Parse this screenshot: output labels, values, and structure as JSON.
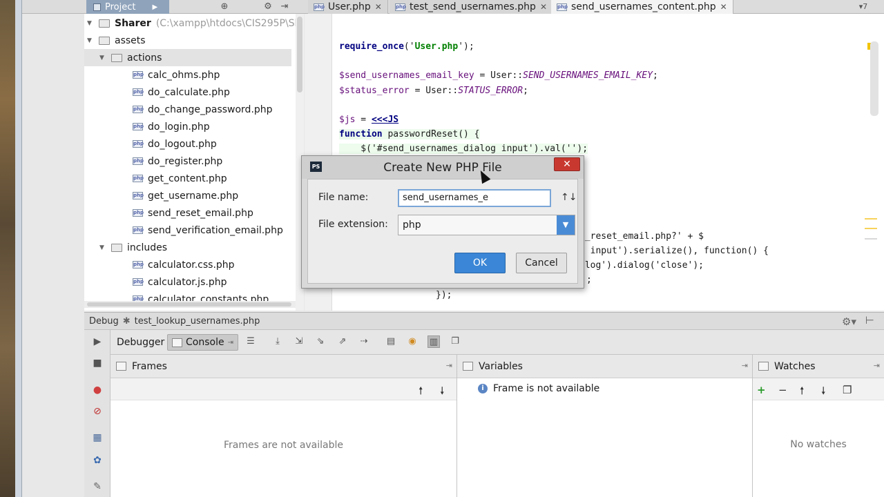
{
  "topbar": {
    "project_tab": "Project",
    "tabs": [
      {
        "label": "User.php"
      },
      {
        "label": "test_send_usernames.php"
      },
      {
        "label": "send_usernames_content.php"
      }
    ],
    "tab_overflow": "▾7"
  },
  "tree": {
    "root_name": "Sharer",
    "root_path": "(C:\\xampp\\htdocs\\CIS295P\\Sharer)",
    "folder_assets": "assets",
    "folder_actions": "actions",
    "files_actions": [
      "calc_ohms.php",
      "do_calculate.php",
      "do_change_password.php",
      "do_login.php",
      "do_logout.php",
      "do_register.php",
      "get_content.php",
      "get_username.php",
      "send_reset_email.php",
      "send_verification_email.php"
    ],
    "folder_includes": "includes",
    "files_includes": [
      "calculator.css.php",
      "calculator.js.php",
      "calculator_constants.php"
    ]
  },
  "editor": {
    "line1a": "require_once",
    "line1b": "('",
    "line1c": "User.php",
    "line1d": "');",
    "line2a": "$send_usernames_email_key",
    "line2b": " = User::",
    "line2c": "SEND_USERNAMES_EMAIL_KEY",
    "line2d": ";",
    "line3a": "$status_error",
    "line3b": " = User::",
    "line3c": "STATUS_ERROR",
    "line3d": ";",
    "line4a": "$js",
    "line4b": " = ",
    "line4c": "<<<JS",
    "line5a": "function",
    "line5b": " passwordReset() {",
    "line6": "    $('#send_usernames_dialog input').val('');",
    "line7": "d_reset_email.php?' + $",
    "line8": "g input').serialize(), function() {",
    "line9": "alog').dialog('close');",
    "line10": ";",
    "line11": "});"
  },
  "dialog": {
    "title": "Create New PHP File",
    "file_name_label": "File name:",
    "file_name_value": "send_usernames_e",
    "file_extension_label": "File extension:",
    "file_extension_value": "php",
    "ok_label": "OK",
    "cancel_label": "Cancel",
    "logo_text": "PS"
  },
  "debug": {
    "header_label": "Debug",
    "config_name": "test_lookup_usernames.php",
    "tab_debugger": "Debugger",
    "tab_console": "Console",
    "frames_title": "Frames",
    "frames_empty": "Frames are not available",
    "variables_title": "Variables",
    "variables_msg": "Frame is not available",
    "watches_title": "Watches",
    "watches_empty": "No watches"
  }
}
